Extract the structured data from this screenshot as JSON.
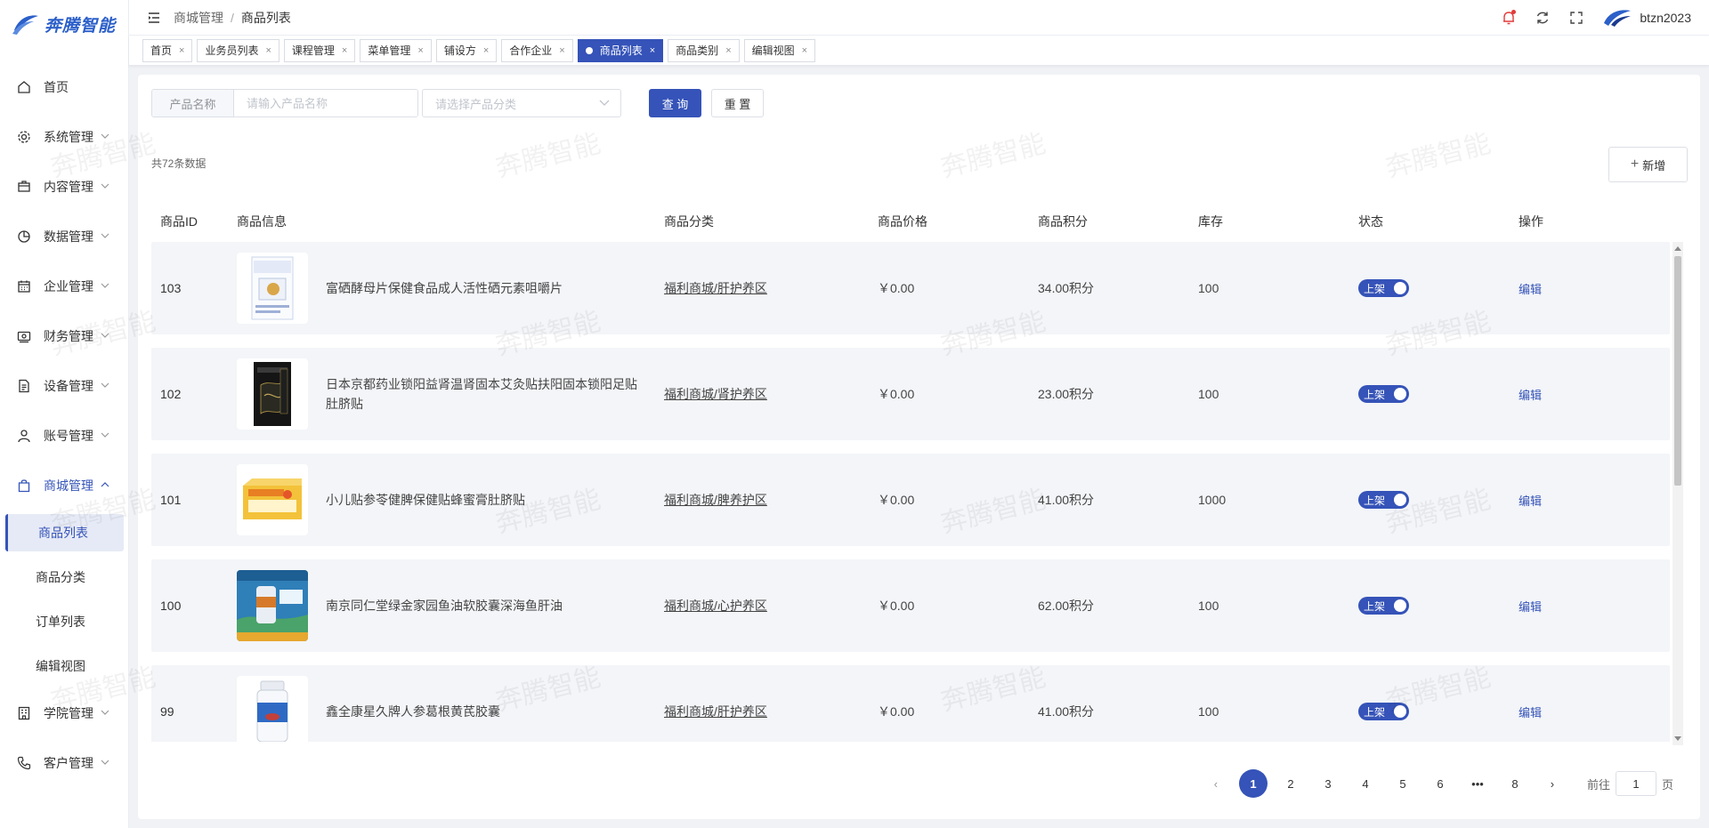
{
  "app": {
    "logo_text": "奔腾智能",
    "watermark": "奔腾智能"
  },
  "sidebar": {
    "items": [
      {
        "label": "首页",
        "icon": "home-icon",
        "expandable": false
      },
      {
        "label": "系统管理",
        "icon": "gear-icon",
        "expandable": true
      },
      {
        "label": "内容管理",
        "icon": "box-icon",
        "expandable": true
      },
      {
        "label": "数据管理",
        "icon": "pie-chart-icon",
        "expandable": true
      },
      {
        "label": "企业管理",
        "icon": "calendar-icon",
        "expandable": true
      },
      {
        "label": "财务管理",
        "icon": "money-icon",
        "expandable": true
      },
      {
        "label": "设备管理",
        "icon": "document-icon",
        "expandable": true
      },
      {
        "label": "账号管理",
        "icon": "user-icon",
        "expandable": true
      },
      {
        "label": "商城管理",
        "icon": "shopping-bag-icon",
        "expandable": true,
        "expanded": true
      }
    ],
    "sub_items": [
      {
        "label": "商品列表",
        "active": true
      },
      {
        "label": "商品分类",
        "active": false
      },
      {
        "label": "订单列表",
        "active": false
      },
      {
        "label": "编辑视图",
        "active": false
      }
    ],
    "after_items": [
      {
        "label": "学院管理",
        "icon": "building-icon",
        "expandable": true
      },
      {
        "label": "客户管理",
        "icon": "phone-icon",
        "expandable": true
      }
    ]
  },
  "header": {
    "breadcrumb": [
      "商城管理",
      "商品列表"
    ],
    "username": "btzn2023"
  },
  "tags": [
    {
      "label": "首页",
      "active": false
    },
    {
      "label": "业务员列表",
      "active": false
    },
    {
      "label": "课程管理",
      "active": false
    },
    {
      "label": "菜单管理",
      "active": false
    },
    {
      "label": "铺设方",
      "active": false
    },
    {
      "label": "合作企业",
      "active": false
    },
    {
      "label": "商品列表",
      "active": true
    },
    {
      "label": "商品类别",
      "active": false
    },
    {
      "label": "编辑视图",
      "active": false
    }
  ],
  "search": {
    "name_label": "产品名称",
    "name_placeholder": "请输入产品名称",
    "category_placeholder": "请选择产品分类",
    "query_label": "查 询",
    "reset_label": "重 置"
  },
  "total_text": "共72条数据",
  "add_label": "新增",
  "table": {
    "columns": [
      "商品ID",
      "商品信息",
      "商品分类",
      "商品价格",
      "商品积分",
      "库存",
      "状态",
      "操作"
    ],
    "rows": [
      {
        "id": "103",
        "name": "富硒酵母片保健食品成人活性硒元素咀嚼片",
        "category": "福利商城/肝护养区",
        "price": "￥0.00",
        "points": "34.00积分",
        "stock": "100",
        "status": "上架",
        "action": "编辑",
        "thumb": "white-box"
      },
      {
        "id": "102",
        "name": "日本京都药业锁阳益肾温肾固本艾灸贴扶阳固本锁阳足贴肚脐贴",
        "category": "福利商城/肾护养区",
        "price": "￥0.00",
        "points": "23.00积分",
        "stock": "100",
        "status": "上架",
        "action": "编辑",
        "thumb": "black-box"
      },
      {
        "id": "101",
        "name": "小儿贴参苓健脾保健贴蜂蜜膏肚脐贴",
        "category": "福利商城/脾养护区",
        "price": "￥0.00",
        "points": "41.00积分",
        "stock": "1000",
        "status": "上架",
        "action": "编辑",
        "thumb": "yellow-box"
      },
      {
        "id": "100",
        "name": "南京同仁堂绿金家园鱼油软胶囊深海鱼肝油",
        "category": "福利商城/心护养区",
        "price": "￥0.00",
        "points": "62.00积分",
        "stock": "100",
        "status": "上架",
        "action": "编辑",
        "thumb": "blue-poster"
      },
      {
        "id": "99",
        "name": "鑫全康星久牌人参葛根黄芪胶囊",
        "category": "福利商城/肝护养区",
        "price": "￥0.00",
        "points": "41.00积分",
        "stock": "100",
        "status": "上架",
        "action": "编辑",
        "thumb": "white-bottle"
      }
    ]
  },
  "pagination": {
    "pages": [
      "1",
      "2",
      "3",
      "4",
      "5",
      "6",
      "•••",
      "8"
    ],
    "current": "1",
    "goto_prefix": "前往",
    "goto_value": "1",
    "goto_suffix": "页"
  },
  "colors": {
    "primary": "#3553b8",
    "row_bg": "#f3f5f8",
    "badge": "#e23b3b"
  }
}
